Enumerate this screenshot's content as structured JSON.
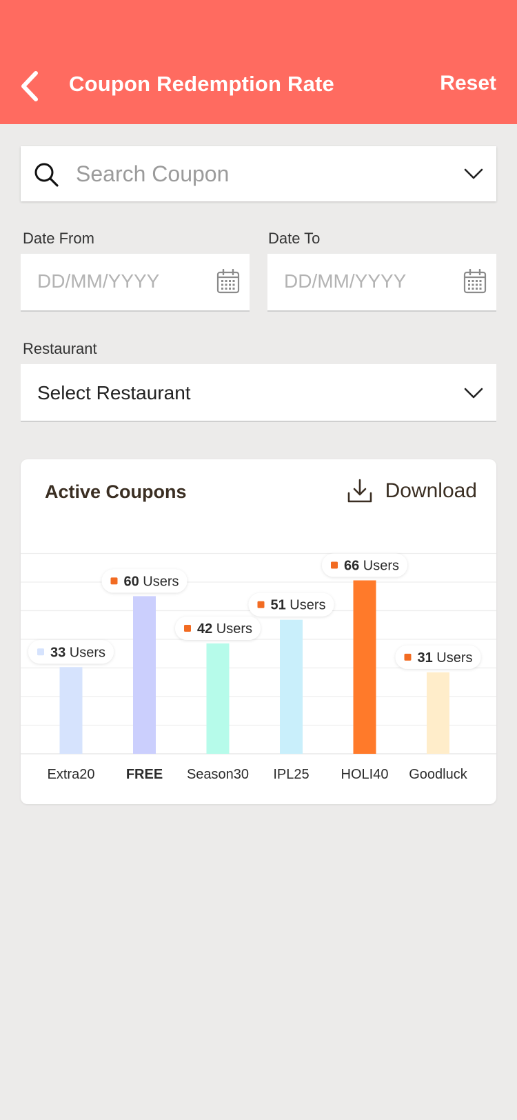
{
  "header": {
    "title": "Coupon Redemption Rate",
    "reset_label": "Reset",
    "bg_color": "#ff6b60"
  },
  "search": {
    "placeholder": "Search Coupon",
    "value": ""
  },
  "date_from": {
    "label": "Date From",
    "placeholder": "DD/MM/YYYY"
  },
  "date_to": {
    "label": "Date To",
    "placeholder": "DD/MM/YYYY"
  },
  "restaurant": {
    "label": "Restaurant",
    "value": "Select Restaurant"
  },
  "card": {
    "title": "Active Coupons",
    "download_label": "Download"
  },
  "chart_data": {
    "type": "bar",
    "title": "Active Coupons",
    "categories": [
      "Extra20",
      "FREE",
      "Season30",
      "IPL25",
      "HOLI40",
      "Goodluck"
    ],
    "values": [
      33,
      60,
      42,
      51,
      66,
      31
    ],
    "unit_label": "Users",
    "colors": [
      "#d6e3fd",
      "#cbcffd",
      "#b6fbea",
      "#c9effb",
      "#ff7a2a",
      "#ffedca"
    ],
    "marker_colors": [
      "#d6e3fd",
      "#f26b22",
      "#f26b22",
      "#f26b22",
      "#f26b22",
      "#f26b22"
    ],
    "bold_category": "FREE",
    "ylim": [
      0,
      70
    ],
    "grid": true
  }
}
